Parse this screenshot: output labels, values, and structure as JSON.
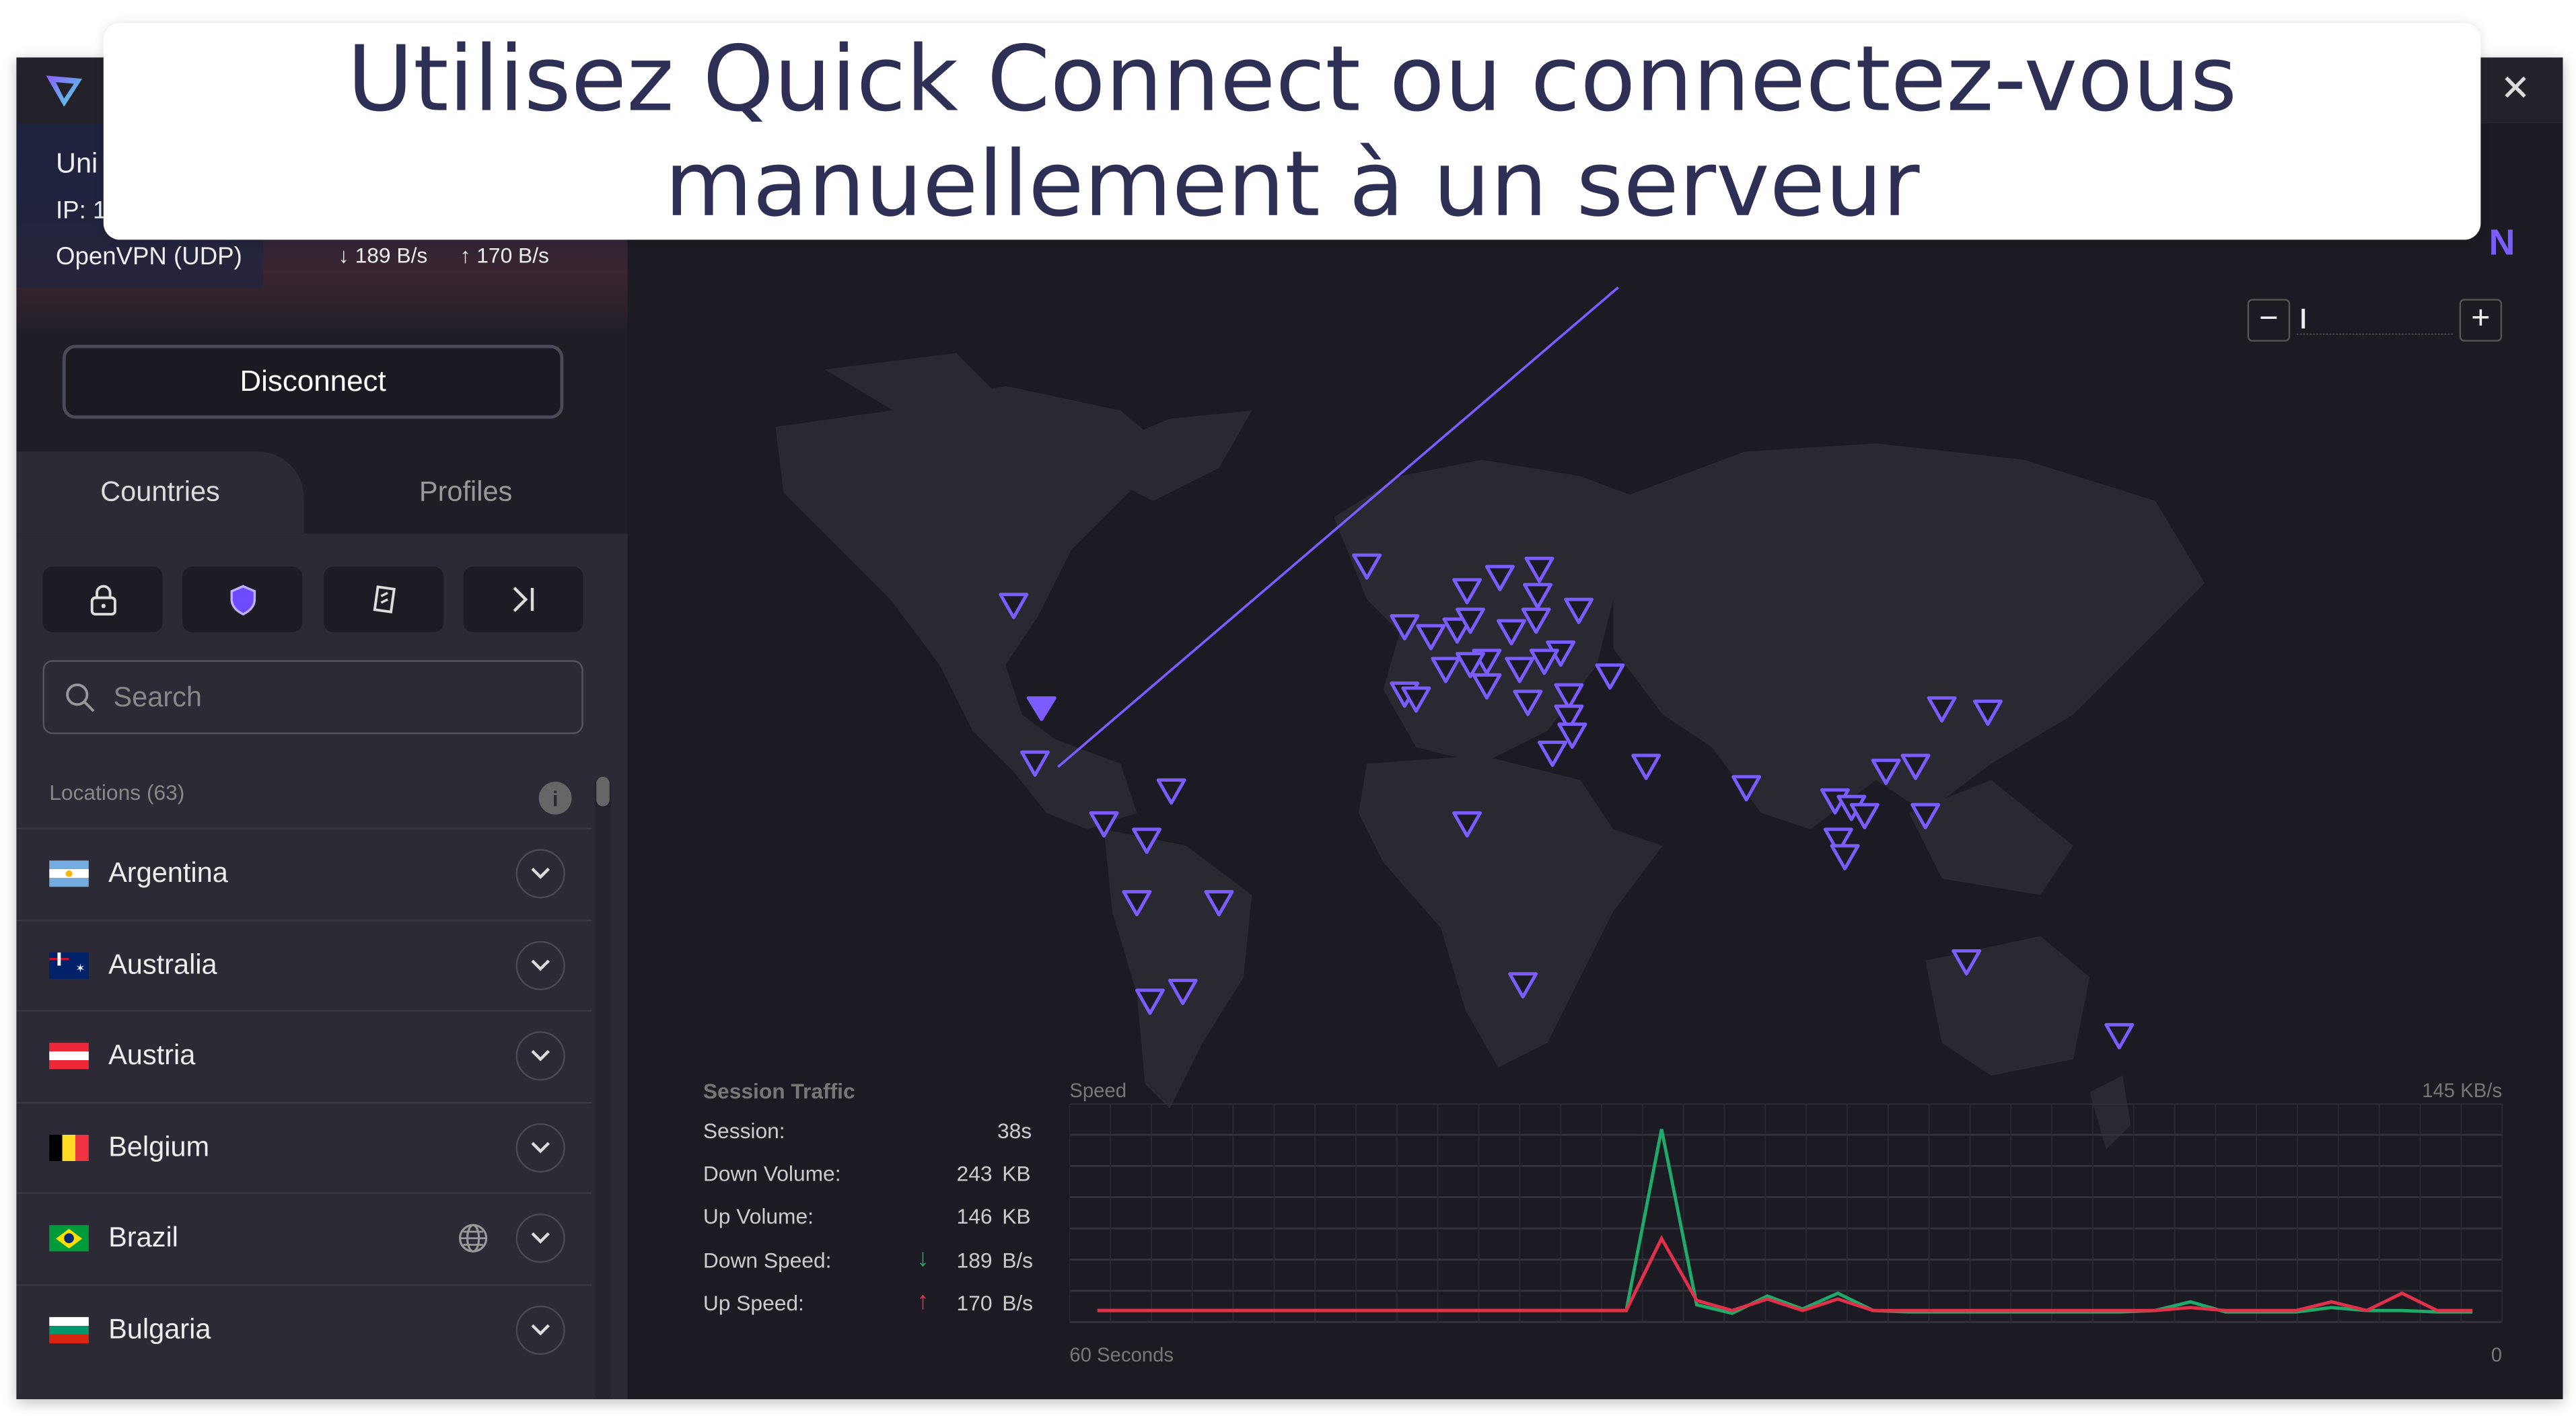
{
  "banner": {
    "line1": "Utilisez Quick Connect ou connectez-vous",
    "line2": "manuellement à un serveur"
  },
  "window": {
    "close_icon": "close-icon",
    "logo_partial": "N"
  },
  "connection": {
    "country_partial": "Uni",
    "ip_partial": "IP: 1",
    "protocol": "OpenVPN (UDP)",
    "down": "189 B/s",
    "up": "170 B/s"
  },
  "sidebar": {
    "disconnect_label": "Disconnect",
    "tabs": [
      {
        "label": "Countries",
        "active": true
      },
      {
        "label": "Profiles",
        "active": false
      }
    ],
    "filters": [
      {
        "icon": "lock-icon"
      },
      {
        "icon": "shield-icon"
      },
      {
        "icon": "p2p-icon"
      },
      {
        "icon": "arrow-right-bar-icon"
      }
    ],
    "search_placeholder": "Search",
    "locations_label": "Locations (63)",
    "countries": [
      {
        "name": "Argentina",
        "flag": "ar"
      },
      {
        "name": "Australia",
        "flag": "au"
      },
      {
        "name": "Austria",
        "flag": "at"
      },
      {
        "name": "Belgium",
        "flag": "be"
      },
      {
        "name": "Brazil",
        "flag": "br",
        "globe": true
      },
      {
        "name": "Bulgaria",
        "flag": "bg"
      }
    ]
  },
  "map": {
    "zoom_out": "−",
    "zoom_in": "+",
    "marker_color": "#7b5cff"
  },
  "traffic": {
    "title": "Session Traffic",
    "rows": [
      {
        "label": "Session:",
        "value": "38s",
        "unit": ""
      },
      {
        "label": "Down Volume:",
        "value": "243",
        "unit": "KB"
      },
      {
        "label": "Up Volume:",
        "value": "146",
        "unit": "KB"
      },
      {
        "label": "Down Speed:",
        "value": "189",
        "unit": "B/s",
        "arrow": "down"
      },
      {
        "label": "Up Speed:",
        "value": "170",
        "unit": "B/s",
        "arrow": "up"
      }
    ],
    "chart_label": "Speed",
    "max_label": "145 KB/s",
    "x_start": "60 Seconds",
    "x_end": "0",
    "colors": {
      "down": "#1faa6a",
      "up": "#e0304a"
    }
  },
  "chart_data": {
    "type": "line",
    "ylim": [
      0,
      145
    ],
    "xlabel": "60 Seconds",
    "series": [
      {
        "key": "down",
        "values": [
          8,
          8,
          8,
          8,
          8,
          8,
          8,
          8,
          8,
          8,
          8,
          8,
          8,
          8,
          8,
          8,
          134,
          12,
          6,
          18,
          9,
          20,
          8,
          7,
          7,
          7,
          7,
          7,
          7,
          7,
          8,
          14,
          7,
          7,
          7,
          10,
          8,
          8,
          7,
          7
        ]
      },
      {
        "key": "up",
        "values": [
          8,
          8,
          8,
          8,
          8,
          8,
          8,
          8,
          8,
          8,
          8,
          8,
          8,
          8,
          8,
          8,
          58,
          15,
          8,
          16,
          8,
          16,
          8,
          8,
          8,
          8,
          8,
          8,
          8,
          8,
          8,
          10,
          8,
          8,
          8,
          14,
          8,
          20,
          8,
          8
        ]
      }
    ]
  }
}
